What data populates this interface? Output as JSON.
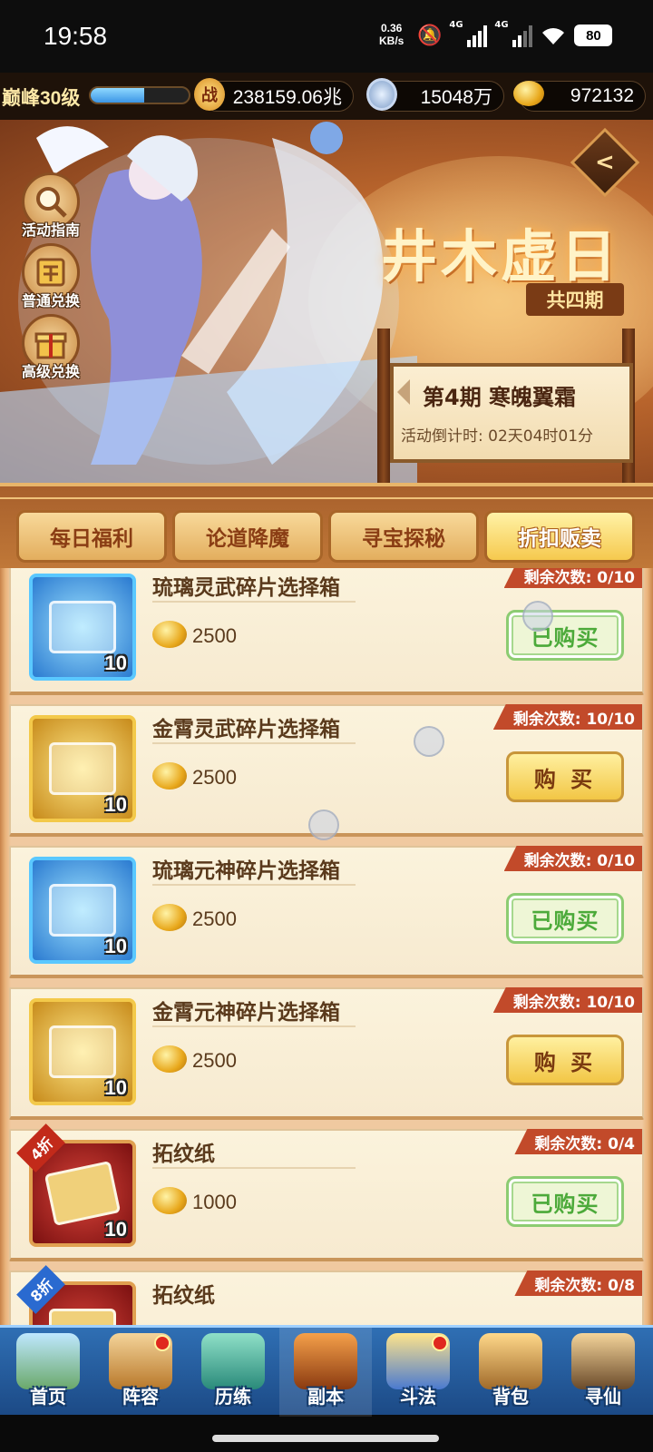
{
  "status": {
    "time": "19:58",
    "net_speed_value": "0.36",
    "net_speed_unit": "KB/s",
    "sim1": "4G",
    "sim2": "4G",
    "battery": "80"
  },
  "resources": {
    "level": "巅峰30级",
    "exp_fraction": 0.55,
    "power_icon": "战",
    "power": "238159.06兆",
    "silver": "15048万",
    "gold": "972132"
  },
  "banner": {
    "title": "井木虚日",
    "subtitle": "共四期",
    "period": "第4期  寒魄翼霜",
    "countdown": "活动倒计时: 02天04时01分",
    "side_buttons": [
      "活动指南",
      "普通兑换",
      "高级兑换"
    ]
  },
  "tabs": [
    "每日福利",
    "论道降魔",
    "寻宝探秘",
    "折扣贩卖"
  ],
  "active_tab": 3,
  "items": [
    {
      "name": "琉璃灵武碎片选择箱",
      "price": "2500",
      "remain": "剩余次数: 0/10",
      "button": "已购买",
      "icon_color": "blue",
      "count": "10"
    },
    {
      "name": "金霄灵武碎片选择箱",
      "price": "2500",
      "remain": "剩余次数: 10/10",
      "button": "购 买",
      "icon_color": "gold",
      "count": "10"
    },
    {
      "name": "琉璃元神碎片选择箱",
      "price": "2500",
      "remain": "剩余次数: 0/10",
      "button": "已购买",
      "icon_color": "blue",
      "count": "10"
    },
    {
      "name": "金霄元神碎片选择箱",
      "price": "2500",
      "remain": "剩余次数: 10/10",
      "button": "购 买",
      "icon_color": "gold",
      "count": "10"
    },
    {
      "name": "拓纹纸",
      "price": "1000",
      "remain": "剩余次数: 0/4",
      "button": "已购买",
      "icon_color": "red",
      "count": "10",
      "discount": "4折"
    },
    {
      "name": "拓纹纸",
      "price": "",
      "remain": "剩余次数: 0/8",
      "button": "",
      "icon_color": "red",
      "count": "",
      "discount": "8折"
    }
  ],
  "nav": [
    {
      "label": "首页",
      "dot": false
    },
    {
      "label": "阵容",
      "dot": true
    },
    {
      "label": "历练",
      "dot": false
    },
    {
      "label": "副本",
      "dot": false
    },
    {
      "label": "斗法",
      "dot": true
    },
    {
      "label": "背包",
      "dot": false
    },
    {
      "label": "寻仙",
      "dot": false
    }
  ],
  "colors": {
    "accent": "#f2c645",
    "remain_tag": "#c24a2a",
    "bought": "#4caa3a"
  }
}
